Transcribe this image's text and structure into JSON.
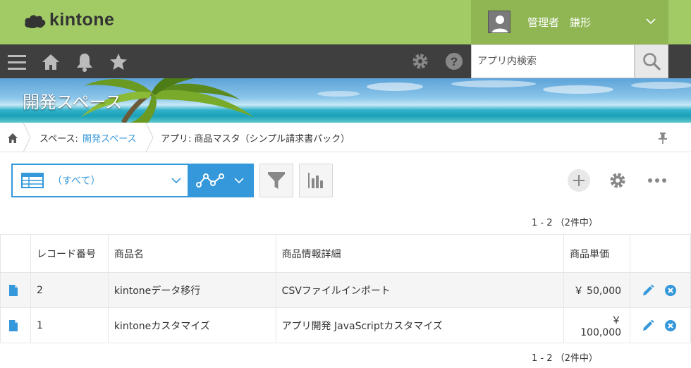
{
  "header": {
    "logo_text": "kintone",
    "user_name": "管理者　鎌形"
  },
  "nav": {
    "search_placeholder": "アプリ内検索"
  },
  "banner": {
    "title": "開発スペース"
  },
  "breadcrumb": {
    "space_prefix": "スペース:",
    "space_name": "開発スペース",
    "app_label": "アプリ: 商品マスタ（シンプル請求書パック）"
  },
  "toolbar": {
    "view_label": "（すべて）"
  },
  "pager": {
    "top": "1 - 2 （2件中）",
    "bottom": "1 - 2 （2件中）"
  },
  "table": {
    "headers": [
      "レコード番号",
      "商品名",
      "商品情報詳細",
      "商品単価"
    ],
    "rows": [
      {
        "id": "2",
        "name": "kintoneデータ移行",
        "detail": "CSVファイルインポート",
        "price": "￥ 50,000"
      },
      {
        "id": "1",
        "name": "kintoneカスタマイズ",
        "detail": "アプリ開発 JavaScriptカスタマイズ",
        "price": "￥ 100,000"
      }
    ]
  },
  "colors": {
    "header_green": "#a2cb66",
    "user_green": "#8fb653",
    "nav_dark": "#3f3f3f",
    "accent_blue": "#3498db"
  }
}
